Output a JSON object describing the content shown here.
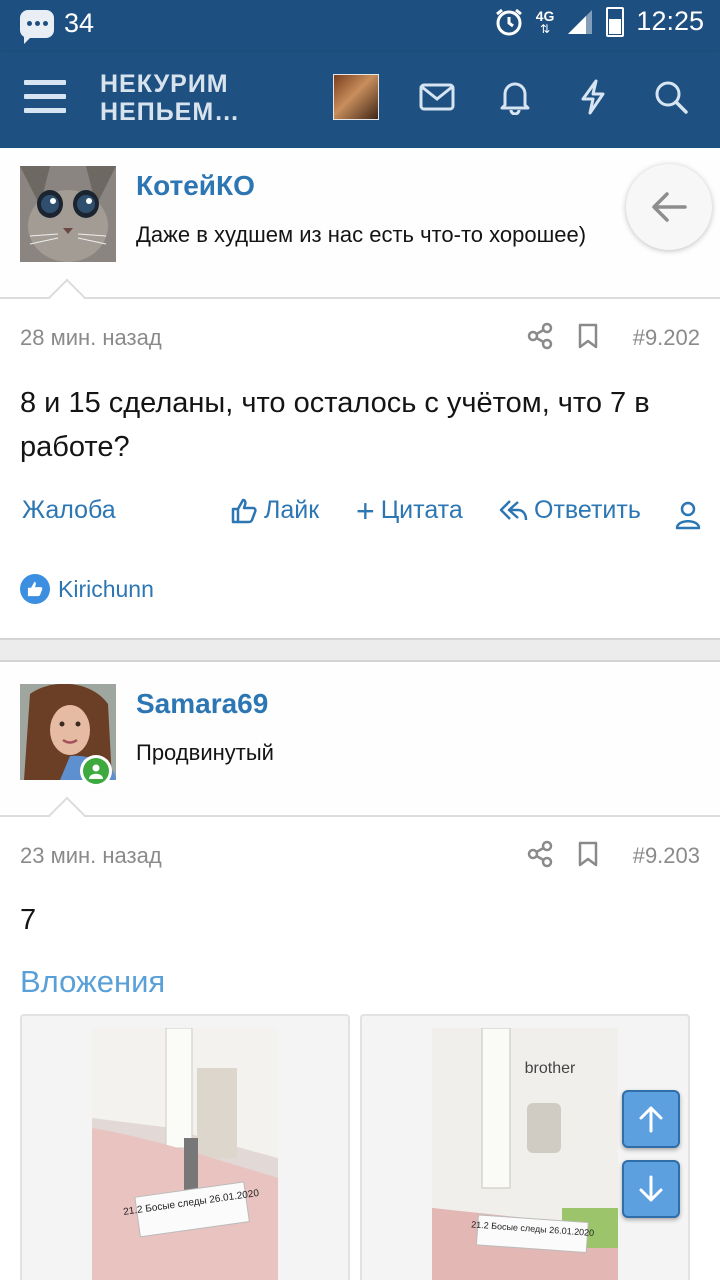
{
  "status_bar": {
    "notification_count": "34",
    "network": "4G",
    "time": "12:25"
  },
  "header": {
    "logo_line1": "НЕКУРИМ",
    "logo_line2": "НЕПЬЕМ…"
  },
  "posts": [
    {
      "username": "КотейКО",
      "user_title": "Даже в худшем из нас есть что-то хорошее)",
      "time": "28 мин. назад",
      "post_number": "#9.202",
      "text": "8 и 15 сделаны, что осталось с учётом, что 7 в работе?",
      "likes": "Kirichunn"
    },
    {
      "username": "Samara69",
      "user_title": "Продвинутый",
      "time": "23 мин. назад",
      "post_number": "#9.203",
      "text": "7",
      "attachments_title": "Вложения"
    }
  ],
  "actions": {
    "report": "Жалоба",
    "like": "Лайк",
    "quote": "Цитата",
    "reply": "Ответить"
  },
  "attachments": {
    "label1": "21.2 Босые следы 26.01.2020",
    "label2": "21.2 Босые следы 26.01.2020",
    "brand": "brother"
  },
  "colors": {
    "header": "#1e5182",
    "link": "#2c76b3",
    "online": "#3eaa3e"
  }
}
